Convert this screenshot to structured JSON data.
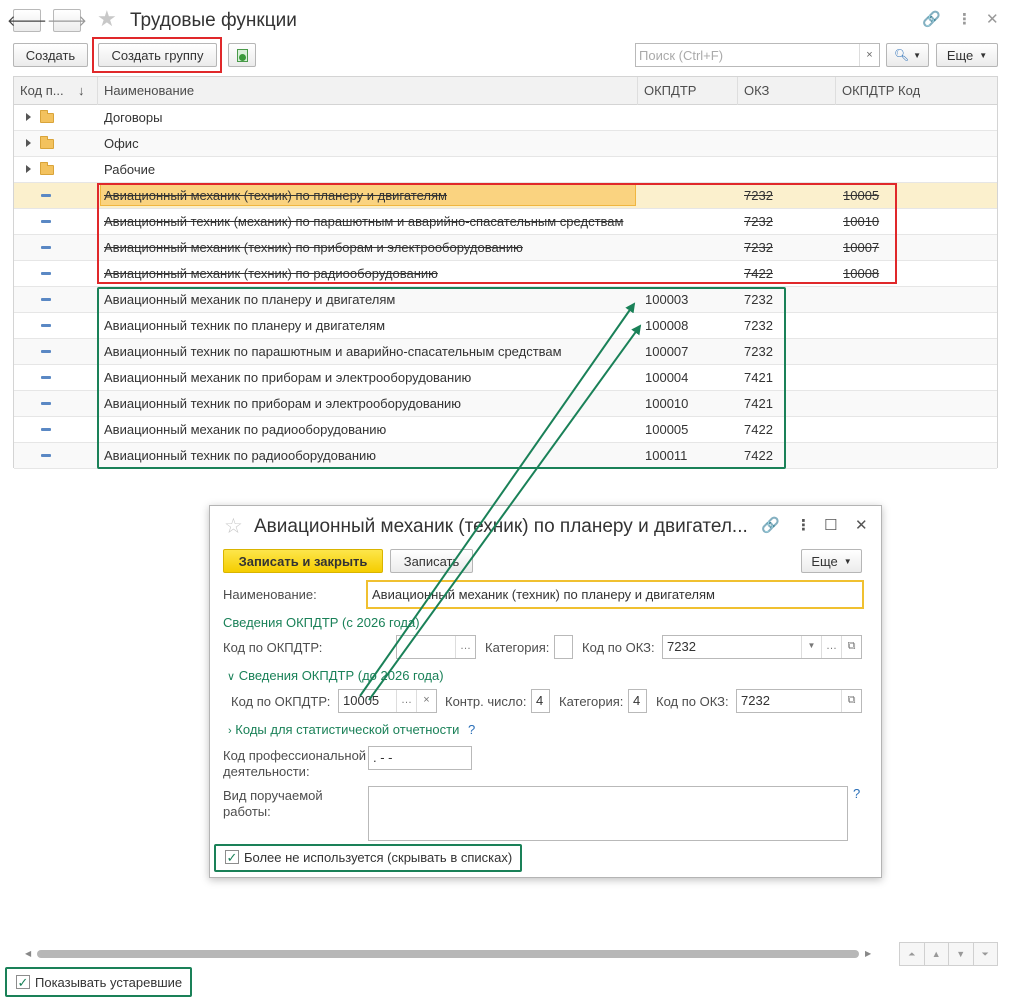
{
  "window": {
    "title": "Трудовые функции"
  },
  "toolbar": {
    "create_label": "Создать",
    "create_group_label": "Создать группу",
    "search_placeholder": "Поиск (Ctrl+F)",
    "search_clear": "×",
    "more_label": "Еще"
  },
  "table": {
    "columns": [
      "Код п...",
      "Наименование",
      "ОКПДТР",
      "ОКЗ",
      "ОКПДТР Код"
    ],
    "groups": [
      {
        "name": "Договоры"
      },
      {
        "name": "Офис"
      },
      {
        "name": "Рабочие"
      }
    ],
    "obsolete_rows": [
      {
        "name": "Авиационный механик (техник) по планеру и двигателям",
        "okpdtr": "",
        "okz": "7232",
        "okpdtr_code": "10005"
      },
      {
        "name": "Авиационный техник (механик) по парашютным и аварийно-спасательным средствам",
        "okpdtr": "",
        "okz": "7232",
        "okpdtr_code": "10010"
      },
      {
        "name": "Авиационный механик (техник) по приборам и электрооборудованию",
        "okpdtr": "",
        "okz": "7232",
        "okpdtr_code": "10007"
      },
      {
        "name": "Авиационный механик (техник) по радиооборудованию",
        "okpdtr": "",
        "okz": "7422",
        "okpdtr_code": "10008"
      }
    ],
    "new_rows": [
      {
        "name": "Авиационный механик по планеру и двигателям",
        "okpdtr": "100003",
        "okz": "7232"
      },
      {
        "name": "Авиационный техник по планеру и двигателям",
        "okpdtr": "100008",
        "okz": "7232"
      },
      {
        "name": "Авиационный техник по парашютным и аварийно-спасательным средствам",
        "okpdtr": "100007",
        "okz": "7232"
      },
      {
        "name": "Авиационный механик по приборам и электрооборудованию",
        "okpdtr": "100004",
        "okz": "7421"
      },
      {
        "name": "Авиационный техник по приборам и электрооборудованию",
        "okpdtr": "100010",
        "okz": "7421"
      },
      {
        "name": "Авиационный механик по радиооборудованию",
        "okpdtr": "100005",
        "okz": "7422"
      },
      {
        "name": "Авиационный техник по радиооборудованию",
        "okpdtr": "100011",
        "okz": "7422"
      }
    ]
  },
  "footer": {
    "show_obsolete_label": "Показывать устаревшие",
    "show_obsolete_checked": true
  },
  "dialog": {
    "title": "Авиационный механик (техник) по планеру и двигател...",
    "save_close_label": "Записать и закрыть",
    "save_label": "Записать",
    "more_label": "Еще",
    "name_label": "Наименование:",
    "name_value": "Авиационный механик (техник) по планеру и двигателям",
    "section_2026": "Сведения ОКПДТР (с 2026 года)",
    "code_okpdtr_label": "Код по ОКПДТР:",
    "code_okpdtr_value": "",
    "category_label": "Категория:",
    "category_value": "",
    "code_okz_label": "Код по ОКЗ:",
    "code_okz_value": "7232",
    "section_before_2026": "Сведения ОКПДТР (до 2026 года)",
    "old_code_okpdtr_label": "Код по ОКПДТР:",
    "old_code_okpdtr_value": "10005",
    "control_number_label": "Контр. число:",
    "control_number_value": "4",
    "old_category_label": "Категория:",
    "old_category_value": "4",
    "old_code_okz_label": "Код по ОКЗ:",
    "old_code_okz_value": "7232",
    "stat_codes_label": "Коды для статистической отчетности",
    "help_mark": "?",
    "prof_activity_label_1": "Код профессиональной",
    "prof_activity_label_2": "деятельности:",
    "prof_activity_value": ". - -",
    "work_type_label_1": "Вид поручаемой",
    "work_type_label_2": "работы:",
    "work_type_value": "",
    "no_longer_used_label": "Более не используется (скрывать в списках)",
    "no_longer_used_checked": true
  },
  "colors": {
    "red_highlight": "#e0282a",
    "green_highlight": "#1a8158",
    "selected_row": "#fbf0cd",
    "primary_button": "#f5cd00"
  }
}
